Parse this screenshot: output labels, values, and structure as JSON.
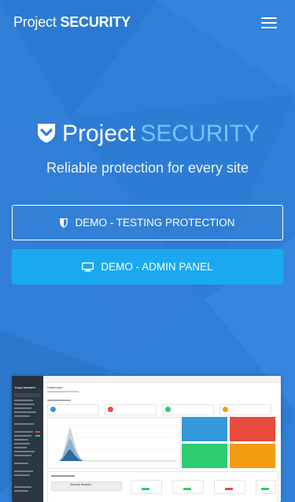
{
  "header": {
    "brand_part1": "Project",
    "brand_part2": "SECURITY",
    "menu_icon": "hamburger-menu-icon"
  },
  "hero": {
    "logo_icon": "shield-check-icon",
    "title_part1": "Project",
    "title_part2": "SECURITY",
    "tagline": "Reliable protection for every site"
  },
  "buttons": {
    "demo_testing": {
      "label": "DEMO - TESTING PROTECTION",
      "icon": "shield-icon"
    },
    "demo_admin": {
      "label": "DEMO - ADMIN PANEL",
      "icon": "desktop-monitor-icon"
    }
  },
  "preview": {
    "app_title": "Project SECURITY",
    "dashboard_title": "Dashboard",
    "module_label": "Security Modules"
  },
  "colors": {
    "background": "#2f7fd6",
    "accent": "#69c8ff",
    "button_solid": "#1aa9ef",
    "tile_blue": "#3498db",
    "tile_red": "#e74c3c",
    "tile_green": "#2ecc71",
    "tile_orange": "#f39c12"
  }
}
